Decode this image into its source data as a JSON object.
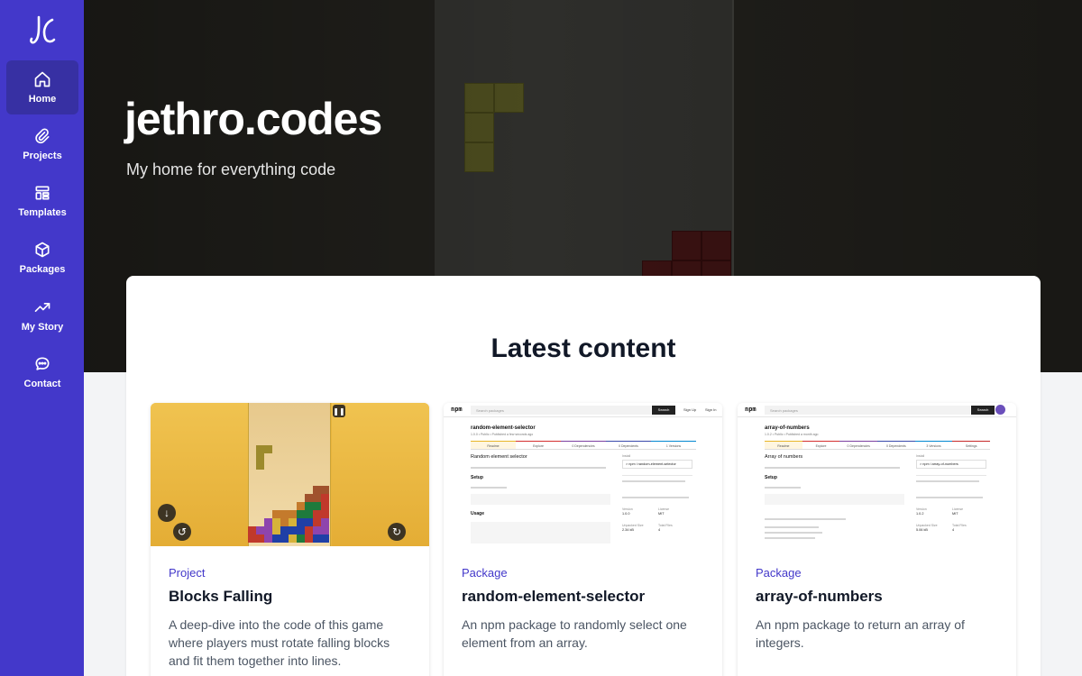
{
  "sidebar": {
    "logo_text": "JC",
    "items": [
      {
        "label": "Home",
        "icon": "home-icon",
        "active": true
      },
      {
        "label": "Projects",
        "icon": "paperclip-icon",
        "active": false
      },
      {
        "label": "Templates",
        "icon": "template-icon",
        "active": false
      },
      {
        "label": "Packages",
        "icon": "cube-icon",
        "active": false
      },
      {
        "label": "My Story",
        "icon": "trending-up-icon",
        "active": false
      },
      {
        "label": "Contact",
        "icon": "chat-icon",
        "active": false
      }
    ]
  },
  "hero": {
    "title": "jethro.codes",
    "subtitle": "My home for everything code"
  },
  "content": {
    "section_title": "Latest content",
    "cards": [
      {
        "type": "Project",
        "title": "Blocks Falling",
        "description": "A deep-dive into the code of this game where players must rotate falling blocks and fit them together into lines."
      },
      {
        "type": "Package",
        "title": "random-element-selector",
        "description": "An npm package to randomly select one element from an array.",
        "thumb": {
          "search_placeholder": "Search packages",
          "search_button": "Search",
          "sign_up": "Sign Up",
          "sign_in": "Sign In",
          "package_name": "random-element-selector",
          "meta": "1.0.0 • Public • Published a few seconds ago",
          "tabs": [
            "Readme",
            "Explore",
            "0 Dependencies",
            "0 Dependents",
            "1 Versions"
          ],
          "heading": "Random element selector",
          "setup": "Setup",
          "usage": "Usage",
          "install_label": "Install",
          "install_cmd": "> npm i random-element-selector",
          "version_label": "Version",
          "version": "1.0.0",
          "license_label": "License",
          "license": "MIT",
          "size_label": "Unpacked Size",
          "size": "2.34 kB",
          "files_label": "Total Files",
          "files": "4"
        }
      },
      {
        "type": "Package",
        "title": "array-of-numbers",
        "description": "An npm package to return an array of integers.",
        "thumb": {
          "search_placeholder": "Search packages",
          "search_button": "Search",
          "package_name": "array-of-numbers",
          "meta": "1.0.2 • Public • Published a month ago",
          "tabs": [
            "Readme",
            "Explore",
            "0 Dependencies",
            "0 Dependents",
            "3 Versions",
            "Settings"
          ],
          "heading": "Array of numbers",
          "setup": "Setup",
          "install_label": "Install",
          "install_cmd": "> npm i array-of-numbers",
          "version_label": "Version",
          "version": "1.0.2",
          "license_label": "License",
          "license": "MIT",
          "size_label": "Unpacked Size",
          "size": "5.06 kB",
          "files_label": "Total Files",
          "files": "4"
        }
      }
    ]
  },
  "colors": {
    "brand": "#4338ca",
    "brand_dark": "#3730a3",
    "hero_bg": "#1f1e1a",
    "accent_text": "#4338ca"
  }
}
